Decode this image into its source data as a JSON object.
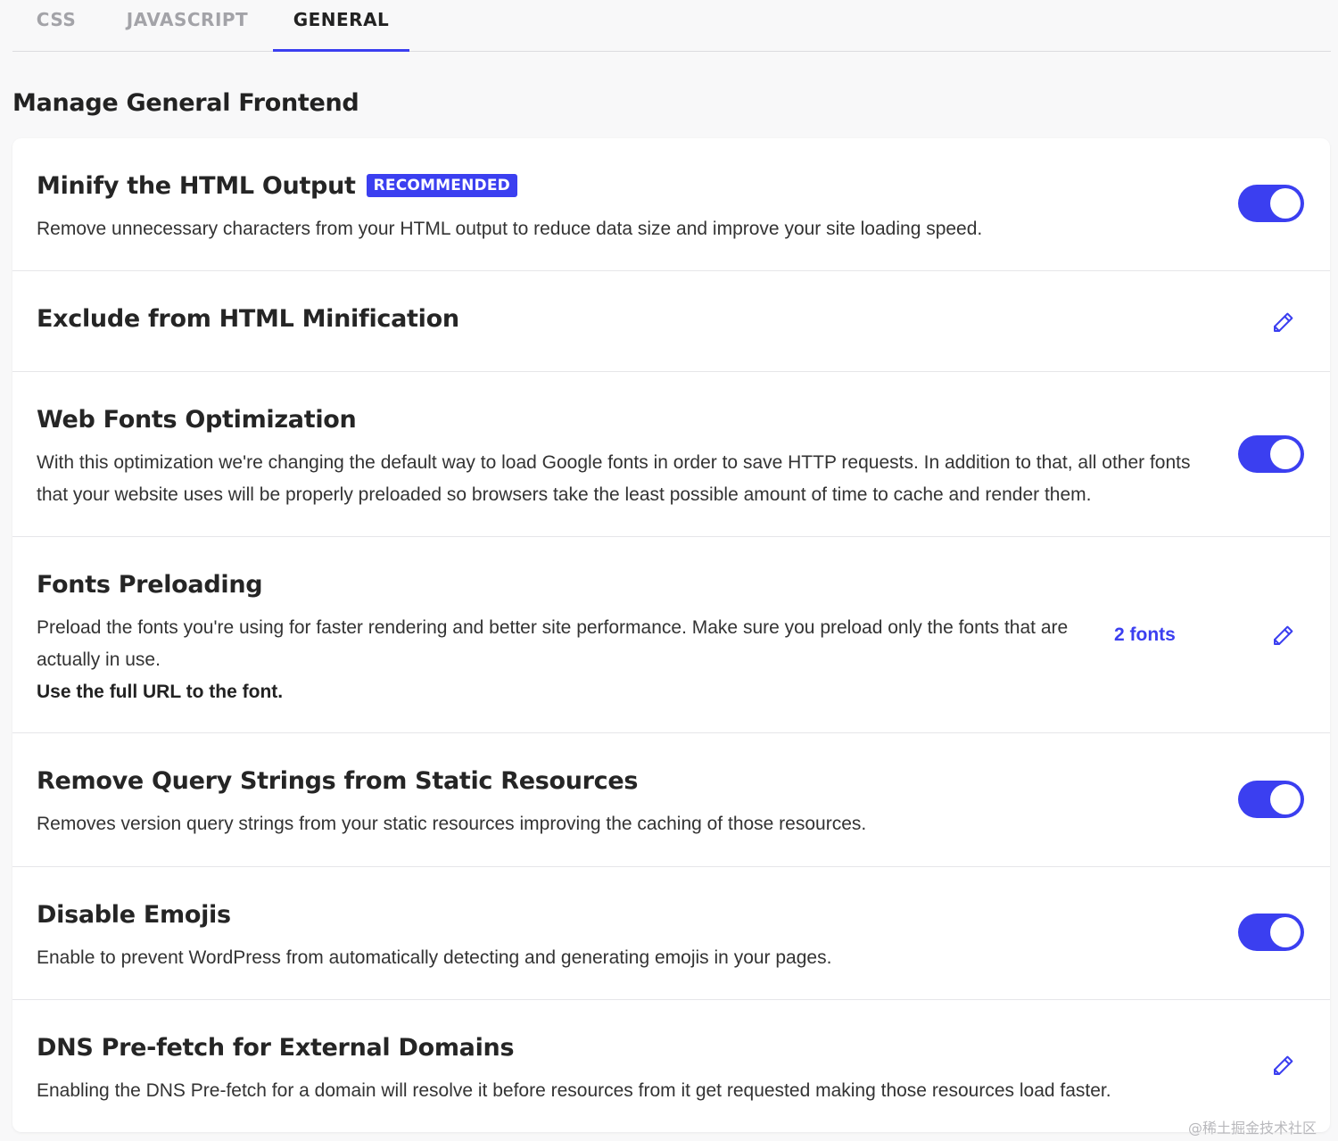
{
  "tabs": [
    {
      "label": "CSS",
      "active": false
    },
    {
      "label": "JAVASCRIPT",
      "active": false
    },
    {
      "label": "GENERAL",
      "active": true
    }
  ],
  "page_title": "Manage General Frontend",
  "settings": [
    {
      "title": "Minify the HTML Output",
      "badge": "RECOMMENDED",
      "description": "Remove unnecessary characters from your HTML output to reduce data size and improve your site loading speed.",
      "control": "toggle",
      "enabled": true
    },
    {
      "title": "Exclude from HTML Minification",
      "control": "edit"
    },
    {
      "title": "Web Fonts Optimization",
      "description": "With this optimization we're changing the default way to load Google fonts in order to save HTTP requests. In addition to that, all other fonts that your website uses will be properly preloaded so browsers take the least possible amount of time to cache and render them.",
      "control": "toggle",
      "enabled": true
    },
    {
      "title": "Fonts Preloading",
      "description": "Preload the fonts you're using for faster rendering and better site performance. Make sure you preload only the fonts that are actually in use.",
      "note": "Use the full URL to the font.",
      "count_label": "2 fonts",
      "control": "edit"
    },
    {
      "title": "Remove Query Strings from Static Resources",
      "description": "Removes version query strings from your static resources improving the caching of those resources.",
      "control": "toggle",
      "enabled": true
    },
    {
      "title": "Disable Emojis",
      "description": "Enable to prevent WordPress from automatically detecting and generating emojis in your pages.",
      "control": "toggle",
      "enabled": true
    },
    {
      "title": "DNS Pre-fetch for External Domains",
      "description": "Enabling the DNS Pre-fetch for a domain will resolve it before resources from it get requested making those resources load faster.",
      "control": "edit"
    }
  ],
  "watermark": "@稀土掘金技术社区",
  "colors": {
    "accent": "#3b3ff0",
    "background": "#f8f8f9",
    "card": "#ffffff",
    "divider": "#e6e6e9"
  },
  "icons": {
    "edit": "pencil-icon"
  }
}
